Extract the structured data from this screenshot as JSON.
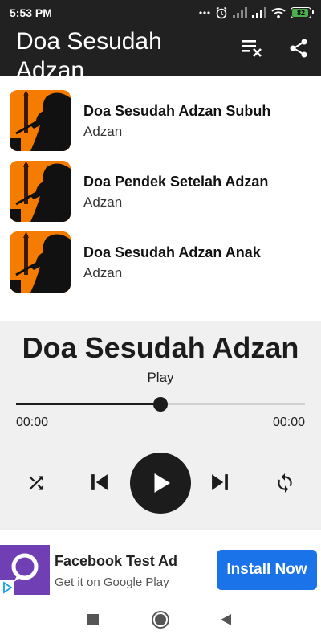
{
  "status_bar": {
    "time": "5:53 PM",
    "battery_level": "82",
    "icons": [
      "more-dots-icon",
      "alarm-icon",
      "signal-icon",
      "signal-icon",
      "wifi-icon",
      "battery-icon"
    ]
  },
  "app_bar": {
    "title": "Doa Sesudah Adzan",
    "actions": [
      "clear-playlist-icon",
      "share-icon"
    ],
    "background": "#212121"
  },
  "playlist": [
    {
      "title": "Doa Sesudah Adzan Subuh",
      "artist": "Adzan"
    },
    {
      "title": "Doa Pendek Setelah Adzan",
      "artist": "Adzan"
    },
    {
      "title": "Doa Sesudah Adzan Anak",
      "artist": "Adzan"
    }
  ],
  "player": {
    "title": "Doa Sesudah Adzan",
    "status": "Play",
    "progress": 0.5,
    "current_time": "00:00",
    "total_time": "00:00",
    "controls": [
      "shuffle-icon",
      "previous-icon",
      "play-icon",
      "next-icon",
      "repeat-icon"
    ]
  },
  "ad": {
    "title": "Facebook Test Ad",
    "subtitle": "Get it on Google Play",
    "cta": "Install Now",
    "cta_color": "#1a73e8",
    "icon_color": "#6f3fb3"
  },
  "nav_bar": {
    "buttons": [
      "recents-square-icon",
      "home-circle-icon",
      "back-triangle-icon"
    ]
  }
}
